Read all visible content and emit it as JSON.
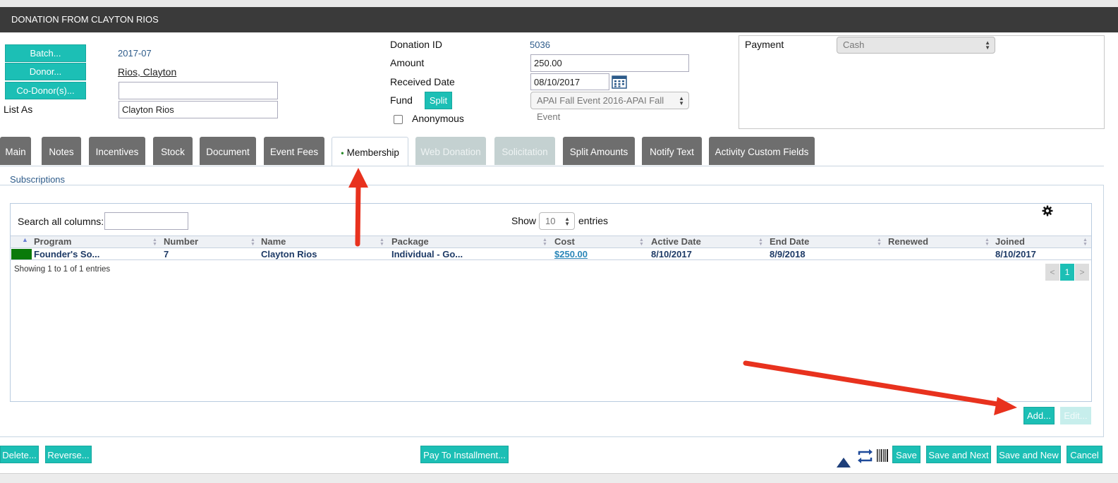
{
  "window": {
    "title": "DONATION FROM CLAYTON RIOS"
  },
  "left": {
    "batch_button": "Batch...",
    "batch_value": "2017-07",
    "donor_button": "Donor...",
    "donor_value": "Rios, Clayton",
    "codonor_button": "Co-Donor(s)...",
    "codonor_value": "",
    "list_as_label": "List As",
    "list_as_value": "Clayton Rios"
  },
  "middle": {
    "donation_id_label": "Donation ID",
    "donation_id_value": "5036",
    "amount_label": "Amount",
    "amount_value": "250.00",
    "received_date_label": "Received Date",
    "received_date_value": "08/10/2017",
    "fund_label": "Fund",
    "split_button": "Split",
    "fund_value": "APAI Fall Event 2016-APAI Fall Event",
    "anonymous_label": "Anonymous",
    "anonymous_checked": false
  },
  "payment": {
    "label": "Payment",
    "value": "Cash"
  },
  "tabs": [
    {
      "label": "Main",
      "state": "normal"
    },
    {
      "label": "Notes",
      "state": "normal"
    },
    {
      "label": "Incentives",
      "state": "normal"
    },
    {
      "label": "Stock",
      "state": "normal"
    },
    {
      "label": "Document",
      "state": "normal"
    },
    {
      "label": "Event Fees",
      "state": "normal"
    },
    {
      "label": "Membership",
      "state": "active"
    },
    {
      "label": "Web Donation",
      "state": "disabled"
    },
    {
      "label": "Solicitation",
      "state": "disabled"
    },
    {
      "label": "Split Amounts",
      "state": "normal"
    },
    {
      "label": "Notify Text",
      "state": "normal"
    },
    {
      "label": "Activity Custom Fields",
      "state": "normal"
    }
  ],
  "subscriptions": {
    "legend": "Subscriptions",
    "search_label": "Search all columns:",
    "search_value": "",
    "show_label": "Show",
    "show_value": "10",
    "entries_label": "entries",
    "columns": [
      "Program",
      "Number",
      "Name",
      "Package",
      "Cost",
      "Active Date",
      "End Date",
      "Renewed",
      "Joined"
    ],
    "rows": [
      {
        "program": "Founder's So...",
        "number": "7",
        "name": "Clayton Rios",
        "package": "Individual - Go...",
        "cost": "$250.00",
        "active_date": "8/10/2017",
        "end_date": "8/9/2018",
        "renewed": "",
        "joined": "8/10/2017",
        "color": "#0a7a0a"
      }
    ],
    "info": "Showing 1 to 1 of 1 entries",
    "pager": {
      "prev": "<",
      "current": "1",
      "next": ">"
    },
    "add_button": "Add...",
    "edit_button": "Edit..."
  },
  "footer": {
    "delete_button": "Delete...",
    "reverse_button": "Reverse...",
    "pay_installment_button": "Pay To Installment...",
    "save_button": "Save",
    "save_next_button": "Save and Next",
    "save_new_button": "Save and New",
    "cancel_button": "Cancel"
  },
  "colors": {
    "accent": "#1cbfb5",
    "titlebar": "#3a3a3a",
    "tab": "#6e6e6e",
    "annotation_arrow": "#e8321e"
  }
}
